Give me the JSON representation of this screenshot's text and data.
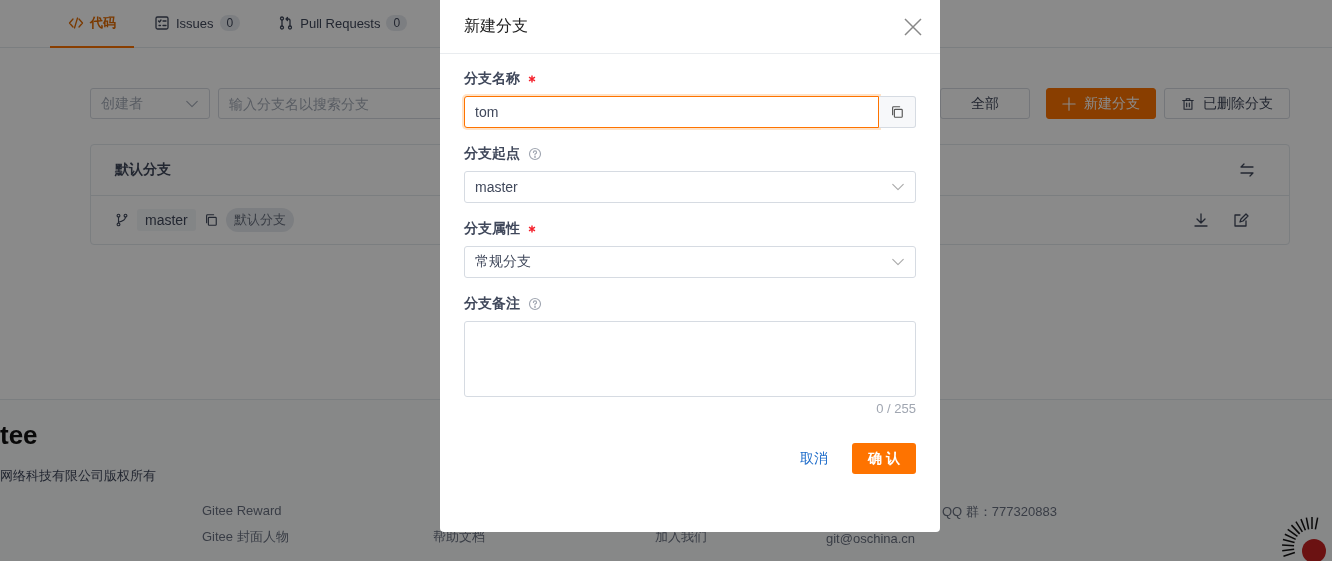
{
  "tabs": [
    {
      "kind": "code",
      "label": "代码",
      "selected": true
    },
    {
      "kind": "issues",
      "label": "Issues",
      "count": "0",
      "selected": false
    },
    {
      "kind": "pulls",
      "label": "Pull Requests",
      "count": "0",
      "selected": false
    }
  ],
  "toolbar": {
    "creator_filter": {
      "placeholder": "创建者"
    },
    "search": {
      "placeholder": "输入分支名以搜索分支"
    },
    "filter_button": "全部",
    "new_button": "新建分支",
    "deleted_button": "已删除分支"
  },
  "default_branch": {
    "title": "默认分支",
    "branch": "master",
    "badge": "默认分支"
  },
  "footer": {
    "logo": "tee",
    "copyright": "网络科技有限公司版权所有",
    "link_columns": [
      [
        "Gitee Reward",
        "Gitee 封面人物"
      ],
      [
        "帮助文档"
      ],
      [
        "加入我们"
      ],
      [
        "git@oschina.cn"
      ],
      [
        "QQ 群：777320883"
      ]
    ]
  },
  "dialog": {
    "title": "新建分支",
    "fields": [
      {
        "kind": "text",
        "label": "分支名称",
        "required": true,
        "help": false,
        "value": "tom",
        "focused": true
      },
      {
        "kind": "select",
        "label": "分支起点",
        "required": false,
        "help": true,
        "value": "master"
      },
      {
        "kind": "select",
        "label": "分支属性",
        "required": true,
        "help": false,
        "value": "常规分支"
      },
      {
        "kind": "textarea",
        "label": "分支备注",
        "required": false,
        "help": true,
        "counter": "0 / 255"
      }
    ],
    "cancel_button": "取消",
    "confirm_button": "确 认"
  }
}
